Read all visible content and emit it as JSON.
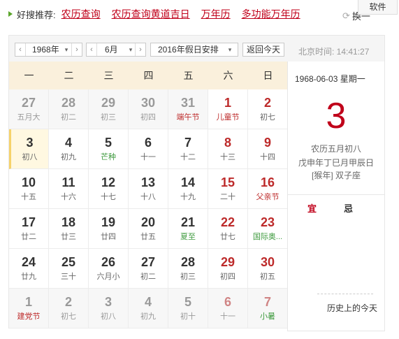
{
  "topbar": {
    "label": "好搜推荐:",
    "links": [
      "农历查询",
      "农历查询黄道吉日",
      "万年历",
      "多功能万年历"
    ],
    "software_button": "软件",
    "refresh_label": "换一"
  },
  "controls": {
    "year": "1968年",
    "month": "6月",
    "holiday_select": "2016年假日安排",
    "today_button": "返回今天",
    "clock": "北京时间: 14:41:27"
  },
  "weekdays": [
    "一",
    "二",
    "三",
    "四",
    "五",
    "六",
    "日"
  ],
  "weeks": [
    [
      {
        "n": "27",
        "s": "五月大",
        "other": true,
        "t": ""
      },
      {
        "n": "28",
        "s": "初二",
        "other": true,
        "t": ""
      },
      {
        "n": "29",
        "s": "初三",
        "other": true,
        "t": ""
      },
      {
        "n": "30",
        "s": "初四",
        "other": true,
        "t": ""
      },
      {
        "n": "31",
        "s": "端午节",
        "other": true,
        "t": "hol"
      },
      {
        "n": "1",
        "s": "儿童节",
        "other": false,
        "t": "hol"
      },
      {
        "n": "2",
        "s": "初七",
        "other": false,
        "t": ""
      }
    ],
    [
      {
        "n": "3",
        "s": "初八",
        "other": false,
        "t": "",
        "today": true
      },
      {
        "n": "4",
        "s": "初九",
        "other": false,
        "t": ""
      },
      {
        "n": "5",
        "s": "芒种",
        "other": false,
        "t": "term"
      },
      {
        "n": "6",
        "s": "十一",
        "other": false,
        "t": ""
      },
      {
        "n": "7",
        "s": "十二",
        "other": false,
        "t": ""
      },
      {
        "n": "8",
        "s": "十三",
        "other": false,
        "t": ""
      },
      {
        "n": "9",
        "s": "十四",
        "other": false,
        "t": ""
      }
    ],
    [
      {
        "n": "10",
        "s": "十五",
        "other": false,
        "t": ""
      },
      {
        "n": "11",
        "s": "十六",
        "other": false,
        "t": ""
      },
      {
        "n": "12",
        "s": "十七",
        "other": false,
        "t": ""
      },
      {
        "n": "13",
        "s": "十八",
        "other": false,
        "t": ""
      },
      {
        "n": "14",
        "s": "十九",
        "other": false,
        "t": ""
      },
      {
        "n": "15",
        "s": "二十",
        "other": false,
        "t": ""
      },
      {
        "n": "16",
        "s": "父亲节",
        "other": false,
        "t": "hol"
      }
    ],
    [
      {
        "n": "17",
        "s": "廿二",
        "other": false,
        "t": ""
      },
      {
        "n": "18",
        "s": "廿三",
        "other": false,
        "t": ""
      },
      {
        "n": "19",
        "s": "廿四",
        "other": false,
        "t": ""
      },
      {
        "n": "20",
        "s": "廿五",
        "other": false,
        "t": ""
      },
      {
        "n": "21",
        "s": "夏至",
        "other": false,
        "t": "term"
      },
      {
        "n": "22",
        "s": "廿七",
        "other": false,
        "t": ""
      },
      {
        "n": "23",
        "s": "国际奥...",
        "other": false,
        "t": "term"
      }
    ],
    [
      {
        "n": "24",
        "s": "廿九",
        "other": false,
        "t": ""
      },
      {
        "n": "25",
        "s": "三十",
        "other": false,
        "t": ""
      },
      {
        "n": "26",
        "s": "六月小",
        "other": false,
        "t": ""
      },
      {
        "n": "27",
        "s": "初二",
        "other": false,
        "t": ""
      },
      {
        "n": "28",
        "s": "初三",
        "other": false,
        "t": ""
      },
      {
        "n": "29",
        "s": "初四",
        "other": false,
        "t": ""
      },
      {
        "n": "30",
        "s": "初五",
        "other": false,
        "t": ""
      }
    ],
    [
      {
        "n": "1",
        "s": "建党节",
        "other": true,
        "t": "hol"
      },
      {
        "n": "2",
        "s": "初七",
        "other": true,
        "t": ""
      },
      {
        "n": "3",
        "s": "初八",
        "other": true,
        "t": ""
      },
      {
        "n": "4",
        "s": "初九",
        "other": true,
        "t": ""
      },
      {
        "n": "5",
        "s": "初十",
        "other": true,
        "t": ""
      },
      {
        "n": "6",
        "s": "十一",
        "other": true,
        "t": ""
      },
      {
        "n": "7",
        "s": "小暑",
        "other": true,
        "t": "term"
      }
    ]
  ],
  "side": {
    "date_line": "1968-06-03  星期一",
    "big_day": "3",
    "lunar": "农历五月初八",
    "ganzhi": "戊申年丁巳月甲辰日",
    "zodiac": "[猴年] 双子座",
    "yi": "宜",
    "ji": "忌",
    "history": "历史上的今天"
  },
  "colors": {
    "accent_red": "#c0001a",
    "weekend_red": "#bd2a2a",
    "solar_term_green": "#3e9a3e",
    "header_bg": "#faf0dc"
  }
}
